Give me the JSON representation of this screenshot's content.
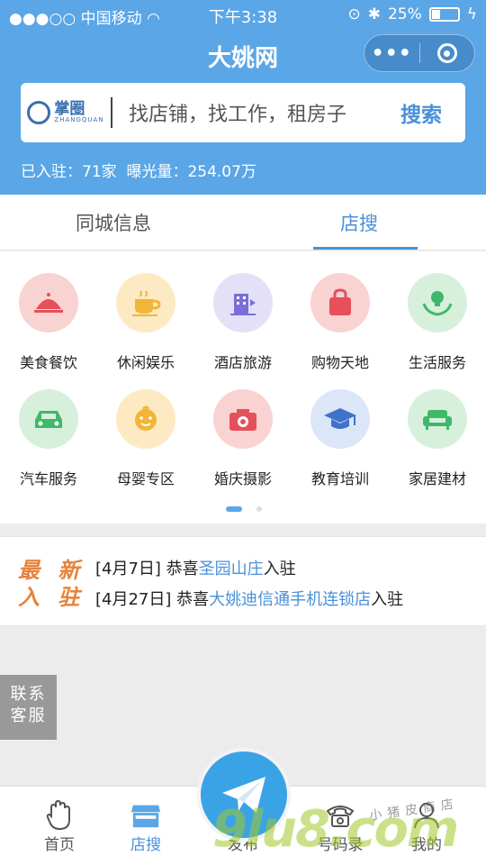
{
  "status_bar": {
    "carrier": "中国移动",
    "time": "下午3:38",
    "battery": "25%"
  },
  "header": {
    "title": "大姚网",
    "capsule_more": "•••"
  },
  "search": {
    "logo_text": "掌圈",
    "logo_sub": "ZHANGQUAN",
    "placeholder": "找店铺，找工作，租房子",
    "button": "搜索"
  },
  "stats": {
    "text": "已入驻：71家  曝光量：254.07万"
  },
  "tabs": [
    {
      "label": "同城信息"
    },
    {
      "label": "店搜"
    }
  ],
  "categories": [
    {
      "label": "美食餐饮",
      "color": "#f9d2d2"
    },
    {
      "label": "休闲娱乐",
      "color": "#fdeac2"
    },
    {
      "label": "酒店旅游",
      "color": "#e4e0f7"
    },
    {
      "label": "购物天地",
      "color": "#f9d2d2"
    },
    {
      "label": "生活服务",
      "color": "#d6f0dc"
    },
    {
      "label": "汽车服务",
      "color": "#d6f0dc"
    },
    {
      "label": "母婴专区",
      "color": "#fdeac2"
    },
    {
      "label": "婚庆摄影",
      "color": "#f9d2d2"
    },
    {
      "label": "教育培训",
      "color": "#dbe7f8"
    },
    {
      "label": "家居建材",
      "color": "#d6f0dc"
    }
  ],
  "news": {
    "badge_top": "最 新",
    "badge_bottom": "入 驻",
    "items": [
      {
        "prefix": "[4月7日] 恭喜",
        "name": "圣园山庄",
        "suffix": "入驻"
      },
      {
        "prefix": "[4月27日] 恭喜",
        "name": "大姚迪信通手机连锁店",
        "suffix": "入驻"
      }
    ]
  },
  "service": {
    "line1": "联系",
    "line2": "客服"
  },
  "bottom_nav": [
    {
      "label": "首页"
    },
    {
      "label": "店搜"
    },
    {
      "label": "发布"
    },
    {
      "label": "号码录"
    },
    {
      "label": "我的"
    }
  ],
  "watermark": {
    "main": "9lu8.com",
    "sub": "小猪皮商店"
  },
  "colors": {
    "primary": "#5aa6e6",
    "accent": "#4a90d9",
    "badge": "#e8833a"
  }
}
